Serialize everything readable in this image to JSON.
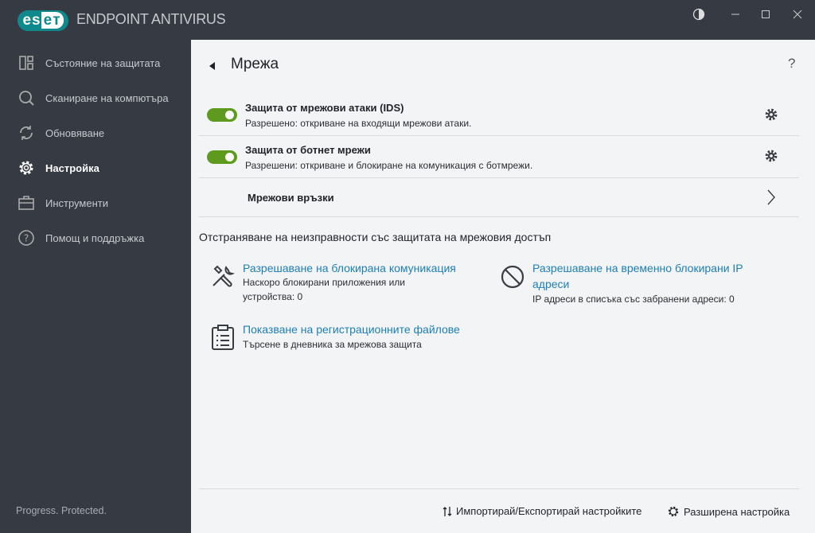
{
  "app": {
    "logo": "eset",
    "product": "ENDPOINT ANTIVIRUS",
    "tagline": "Progress. Protected."
  },
  "sidebar": {
    "items": [
      {
        "label": "Състояние на защитата"
      },
      {
        "label": "Сканиране на компютъра"
      },
      {
        "label": "Обновяване"
      },
      {
        "label": "Настройка"
      },
      {
        "label": "Инструменти"
      },
      {
        "label": "Помощ и поддръжка"
      }
    ]
  },
  "page": {
    "title": "Мрежа",
    "help": "?"
  },
  "rows": [
    {
      "title": "Защита от мрежови атаки (IDS)",
      "status": "Разрешено:",
      "desc": " откриване на входящи мрежови атаки.",
      "enabled": true
    },
    {
      "title": "Защита от ботнет мрежи",
      "status": "Разрешени:",
      "desc": " откриване и блокиране на комуникация с ботмрежи.",
      "enabled": true
    }
  ],
  "network_connections": "Мрежови връзки",
  "troubleshoot": {
    "heading": "Отстраняване на неизправности със защитата на мрежовия достъп",
    "items": [
      {
        "link": "Разрешаване на блокирана комуникация",
        "sub1": "Наскоро блокирани приложения или",
        "sub2": "устройства: 0"
      },
      {
        "link1": "Разрешаване на временно блокирани IP",
        "link2": "адреси",
        "sub": "IP адреси в списъка със забранени адреси: 0"
      },
      {
        "link": "Показване на регистрационните файлове",
        "sub": "Търсене в дневника за мрежова защита"
      }
    ]
  },
  "footer": {
    "import_export": "Импортирай/Експортирай настройките",
    "advanced": "Разширена настройка"
  }
}
